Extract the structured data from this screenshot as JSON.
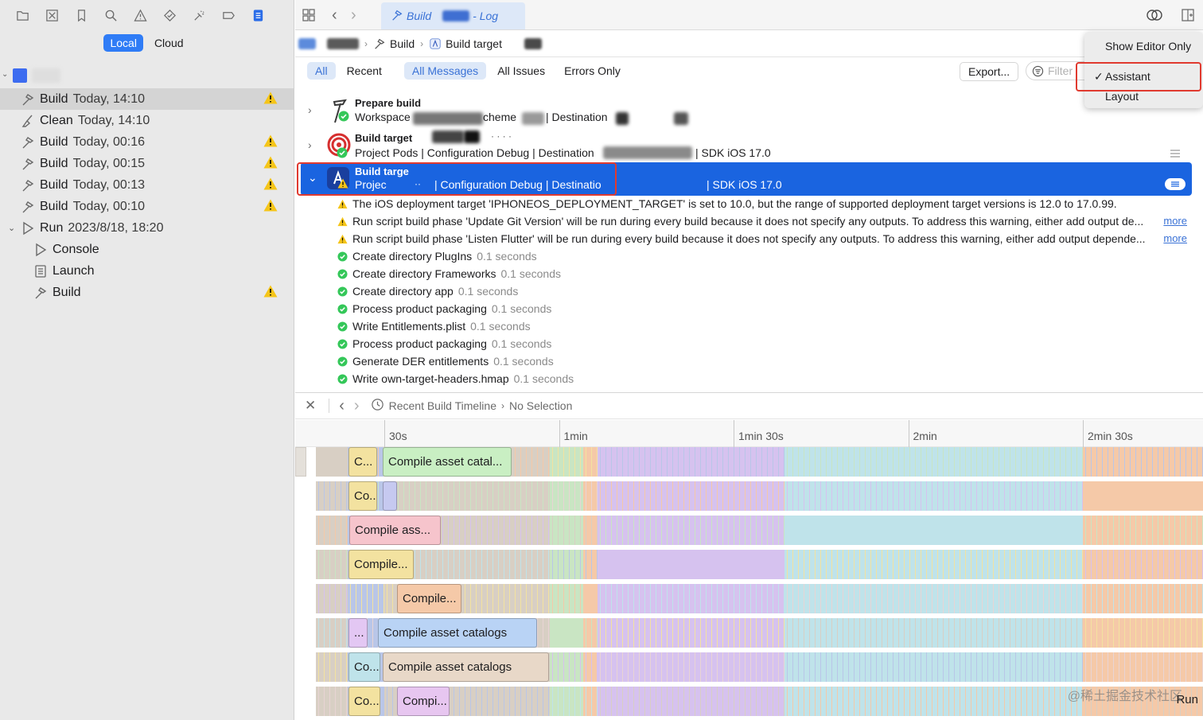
{
  "navigator": {
    "scope": {
      "local": "Local",
      "cloud": "Cloud"
    },
    "logs": [
      {
        "icon": "hammer",
        "title": "Build",
        "time": "Today, 14:10",
        "warn": true,
        "selected": true,
        "indent": 0
      },
      {
        "icon": "broom",
        "title": "Clean",
        "time": "Today, 14:10",
        "warn": false,
        "selected": false,
        "indent": 0
      },
      {
        "icon": "hammer",
        "title": "Build",
        "time": "Today, 00:16",
        "warn": true,
        "selected": false,
        "indent": 0
      },
      {
        "icon": "hammer",
        "title": "Build",
        "time": "Today, 00:15",
        "warn": true,
        "selected": false,
        "indent": 0
      },
      {
        "icon": "hammer",
        "title": "Build",
        "time": "Today, 00:13",
        "warn": true,
        "selected": false,
        "indent": 0
      },
      {
        "icon": "hammer",
        "title": "Build",
        "time": "Today, 00:10",
        "warn": true,
        "selected": false,
        "indent": 0
      },
      {
        "icon": "play",
        "title": "Run",
        "time": "2023/8/18, 18:20",
        "warn": false,
        "selected": false,
        "indent": 0,
        "expanded": true
      },
      {
        "icon": "play",
        "title": "Console",
        "time": "",
        "warn": false,
        "selected": false,
        "indent": 1
      },
      {
        "icon": "doc",
        "title": "Launch",
        "time": "",
        "warn": false,
        "selected": false,
        "indent": 1
      },
      {
        "icon": "hammer",
        "title": "Build",
        "time": "",
        "warn": true,
        "selected": false,
        "indent": 1
      }
    ]
  },
  "editor": {
    "tab": {
      "build": "Build",
      "log": "- Log"
    }
  },
  "jumpbar": {
    "build": "Build",
    "target": "Build target"
  },
  "filters": {
    "all": "All",
    "recent": "Recent",
    "all_messages": "All Messages",
    "all_issues": "All Issues",
    "errors_only": "Errors Only",
    "export": "Export...",
    "filter_placeholder": "Filter"
  },
  "menu": {
    "show_editor_only": "Show Editor Only",
    "assistant": "Assistant",
    "layout": "Layout",
    "check": "✓"
  },
  "build_log": {
    "steps": [
      {
        "title": "Prepare build",
        "detail_a": "Workspace",
        "detail_b": "cheme",
        "detail_c": "| Destination"
      },
      {
        "title": "Build target",
        "detail_a": "Project Pods | Configuration Debug | Destination",
        "detail_b": "| SDK iOS 17.0",
        "dots": "· · · ·"
      },
      {
        "title": "Build targe",
        "detail_a": "Projec",
        "detail_b": "| Configuration Debug | Destinatio",
        "detail_c": "| SDK iOS 17.0",
        "mark": "··"
      }
    ],
    "messages": [
      {
        "type": "warn",
        "text": "The iOS deployment target 'IPHONEOS_DEPLOYMENT_TARGET' is set to 10.0, but the range of supported deployment target versions is 12.0 to 17.0.99.",
        "dur": "",
        "more": ""
      },
      {
        "type": "warn",
        "text": "Run script build phase 'Update Git Version' will be run during every build because it does not specify any outputs. To address this warning, either add output de...",
        "dur": "",
        "more": "more"
      },
      {
        "type": "warn",
        "text": "Run script build phase 'Listen Flutter' will be run during every build because it does not specify any outputs. To address this warning, either add output depende...",
        "dur": "",
        "more": "more"
      },
      {
        "type": "ok",
        "text": "Create directory PlugIns",
        "dur": "0.1 seconds",
        "more": ""
      },
      {
        "type": "ok",
        "text": "Create directory Frameworks",
        "dur": "0.1 seconds",
        "more": ""
      },
      {
        "type": "ok",
        "text": "Create directory              app",
        "dur": "0.1 seconds",
        "more": ""
      },
      {
        "type": "ok",
        "text": "Process product packaging",
        "dur": "0.1 seconds",
        "more": ""
      },
      {
        "type": "ok",
        "text": "Write Entitlements.plist",
        "dur": "0.1 seconds",
        "more": ""
      },
      {
        "type": "ok",
        "text": "Process product packaging",
        "dur": "0.1 seconds",
        "more": ""
      },
      {
        "type": "ok",
        "text": "Generate DER entitlements",
        "dur": "0.1 seconds",
        "more": ""
      },
      {
        "type": "ok",
        "text": "Write               own-target-headers.hmap",
        "dur": "0.1 seconds",
        "more": ""
      }
    ]
  },
  "timeline": {
    "breadcrumb": "Recent Build Timeline",
    "sep": "›",
    "selection": "No Selection",
    "ticks": [
      "30s",
      "1min",
      "1min 30s",
      "2min",
      "2min 30s"
    ],
    "lanes": [
      {
        "short": "C...",
        "label": "Compile asset catal..."
      },
      {
        "short": "Co...",
        "label": ""
      },
      {
        "short": "",
        "label": "Compile ass..."
      },
      {
        "short": "",
        "label": "Compile..."
      },
      {
        "short": "",
        "label": "Compile..."
      },
      {
        "short": "...",
        "label": "Compile asset catalogs"
      },
      {
        "short": "Co...",
        "label": "Compile asset catalogs"
      },
      {
        "short": "Co...",
        "label": "Compi..."
      }
    ],
    "watermark": "@稀土掘金技术社区",
    "run": "Run"
  },
  "colors": {
    "accent": "#2f7cf6",
    "selected_row": "#1a64e0",
    "warning": "#f5c518",
    "success": "#34c759",
    "annotation_red": "#e03a2f"
  }
}
